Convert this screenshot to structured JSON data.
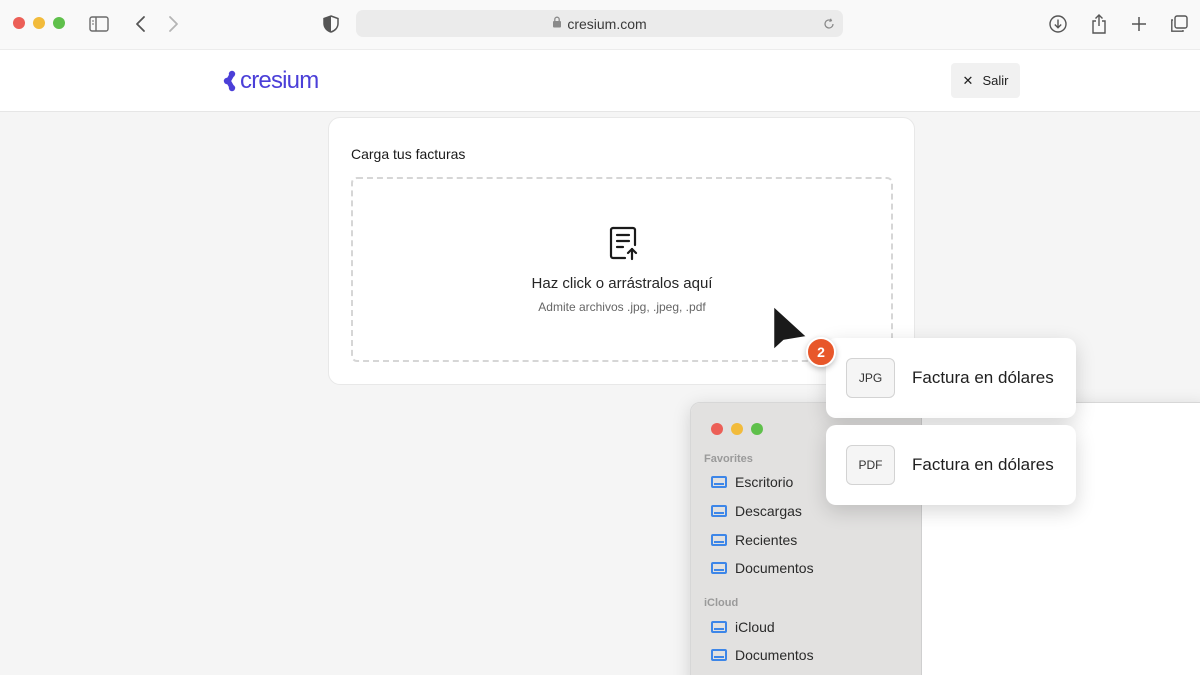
{
  "browser": {
    "url": "cresium.com",
    "traffic_colors": {
      "close": "#ec5f57",
      "minimize": "#f2bb3b",
      "maximize": "#5fc04b"
    }
  },
  "header": {
    "logo_text": "cresium",
    "exit_label": "Salir",
    "brand_color": "#4b3fd8"
  },
  "upload": {
    "title": "Carga tus facturas",
    "dropzone_main": "Haz click o arrástralos aquí",
    "dropzone_hint": "Admite archivos .jpg, .jpeg, .pdf"
  },
  "finder": {
    "favorites_label": "Favorites",
    "favorites": [
      "Escritorio",
      "Descargas",
      "Recientes",
      "Documentos"
    ],
    "icloud_label": "iCloud",
    "icloud": [
      "iCloud",
      "Documentos"
    ],
    "folder_icon_color": "#3d86e8"
  },
  "files": [
    {
      "type": "JPG",
      "name": "Factura en dólares"
    },
    {
      "type": "PDF",
      "name": "Factura en dólares"
    }
  ],
  "step_badge": {
    "number": "2",
    "color": "#e8572a"
  }
}
